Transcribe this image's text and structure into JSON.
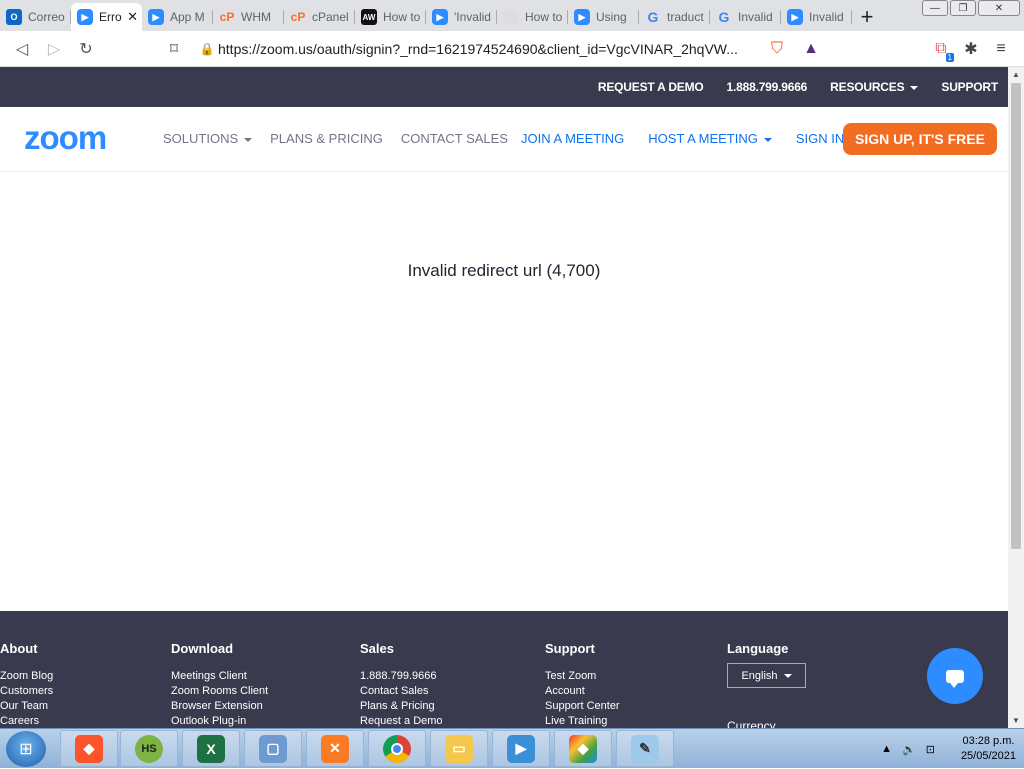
{
  "browser": {
    "tabs": [
      {
        "title": "Correo",
        "icon": "outlook-icon",
        "active": false
      },
      {
        "title": "Erro",
        "icon": "zoom-icon",
        "active": true
      },
      {
        "title": "App M",
        "icon": "zoom-icon",
        "active": false
      },
      {
        "title": "WHM",
        "icon": "cpanel-icon",
        "active": false
      },
      {
        "title": "cPanel",
        "icon": "cpanel-icon",
        "active": false
      },
      {
        "title": "How to",
        "icon": "aw-icon",
        "active": false
      },
      {
        "title": "'Invalid",
        "icon": "zoom-icon",
        "active": false
      },
      {
        "title": "How to",
        "icon": "cd-icon",
        "active": false
      },
      {
        "title": "Using",
        "icon": "zoom-icon",
        "active": false
      },
      {
        "title": "traduct",
        "icon": "google-icon",
        "active": false
      },
      {
        "title": "Invalid",
        "icon": "google-icon",
        "active": false
      },
      {
        "title": "Invalid",
        "icon": "zoom-icon",
        "active": false
      }
    ],
    "url": "https://zoom.us/oauth/signin?_rnd=1621974524690&client_id=VgcVINAR_2hqVW...",
    "ext_badge": "1"
  },
  "zoom": {
    "topbar": {
      "request_demo": "REQUEST A DEMO",
      "phone": "1.888.799.9666",
      "resources": "RESOURCES",
      "support": "SUPPORT"
    },
    "logo": "zoom",
    "nav": {
      "solutions": "SOLUTIONS",
      "plans": "PLANS & PRICING",
      "contact": "CONTACT SALES",
      "join": "JOIN A MEETING",
      "host": "HOST A MEETING",
      "signin": "SIGN IN",
      "signup": "SIGN UP, IT'S FREE"
    },
    "error_message": "Invalid redirect url (4,700)",
    "footer": {
      "about": {
        "title": "About",
        "links": [
          "Zoom Blog",
          "Customers",
          "Our Team",
          "Careers"
        ]
      },
      "download": {
        "title": "Download",
        "links": [
          "Meetings Client",
          "Zoom Rooms Client",
          "Browser Extension",
          "Outlook Plug-in"
        ]
      },
      "sales": {
        "title": "Sales",
        "links": [
          "1.888.799.9666",
          "Contact Sales",
          "Plans & Pricing",
          "Request a Demo"
        ]
      },
      "support": {
        "title": "Support",
        "links": [
          "Test Zoom",
          "Account",
          "Support Center",
          "Live Training"
        ]
      },
      "language": {
        "title": "Language",
        "selected": "English"
      },
      "currency_label": "Currency"
    }
  },
  "taskbar": {
    "time": "03:28 p.m.",
    "date": "25/05/2021"
  },
  "colors": {
    "zoom_blue": "#2d8cff",
    "zoom_dark": "#393a4d",
    "signup_orange": "#f26d21"
  }
}
